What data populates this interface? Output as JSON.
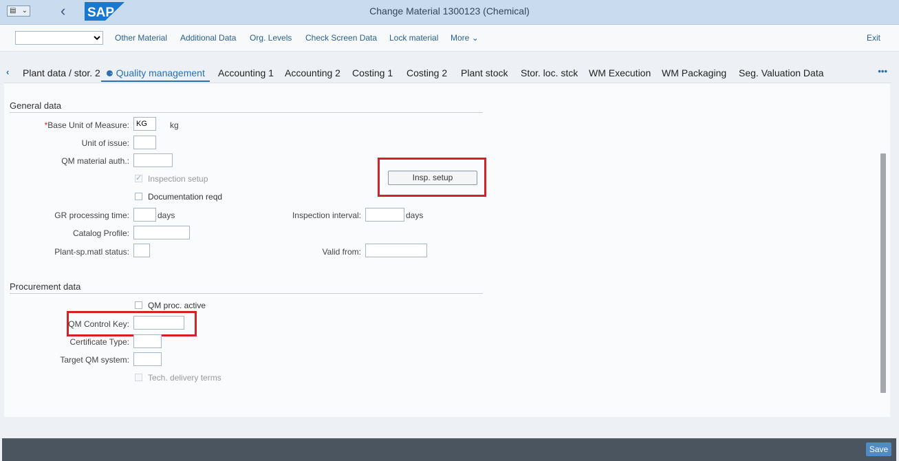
{
  "shell": {
    "title": "Change Material 1300123 (Chemical)",
    "menu_icon": "menu-list-icon",
    "back_icon": "chevron-left-icon",
    "logo_text": "SAP"
  },
  "toolbar": {
    "select_value": "",
    "items": [
      "Other Material",
      "Additional Data",
      "Org. Levels",
      "Check Screen Data",
      "Lock material",
      "More"
    ],
    "exit": "Exit"
  },
  "tabs": {
    "items": [
      "Plant data / stor. 2",
      "Quality management",
      "Accounting 1",
      "Accounting 2",
      "Costing 1",
      "Costing 2",
      "Plant stock",
      "Stor. loc. stck",
      "WM Execution",
      "WM Packaging",
      "Seg. Valuation Data"
    ],
    "active": "Quality management",
    "more": "•••"
  },
  "general": {
    "title": "General data",
    "base_uom_label": "Base Unit of Measure:",
    "base_uom_value": "KG",
    "base_uom_unit": "kg",
    "unit_issue_label": "Unit of issue:",
    "qm_auth_label": "QM material auth.:",
    "insp_setup_label": "Inspection setup",
    "insp_setup_checked": true,
    "doc_reqd_label": "Documentation reqd",
    "insp_button": "Insp. setup",
    "gr_time_label": "GR processing time:",
    "gr_time_unit": "days",
    "insp_interval_label": "Inspection interval:",
    "insp_interval_unit": "days",
    "catalog_label": "Catalog Profile:",
    "plant_status_label": "Plant-sp.matl status:",
    "valid_from_label": "Valid from:"
  },
  "procurement": {
    "title": "Procurement data",
    "qm_proc_label": "QM proc. active",
    "control_key_label": "QM Control Key:",
    "cert_type_label": "Certificate Type:",
    "target_qm_label": "Target QM system:",
    "tech_delivery_label": "Tech. delivery terms"
  },
  "footer": {
    "save": "Save"
  },
  "colors": {
    "highlight": "#d42027",
    "accent": "#2b6fb1",
    "shell": "#c9dbee",
    "footer": "#4b5560"
  }
}
